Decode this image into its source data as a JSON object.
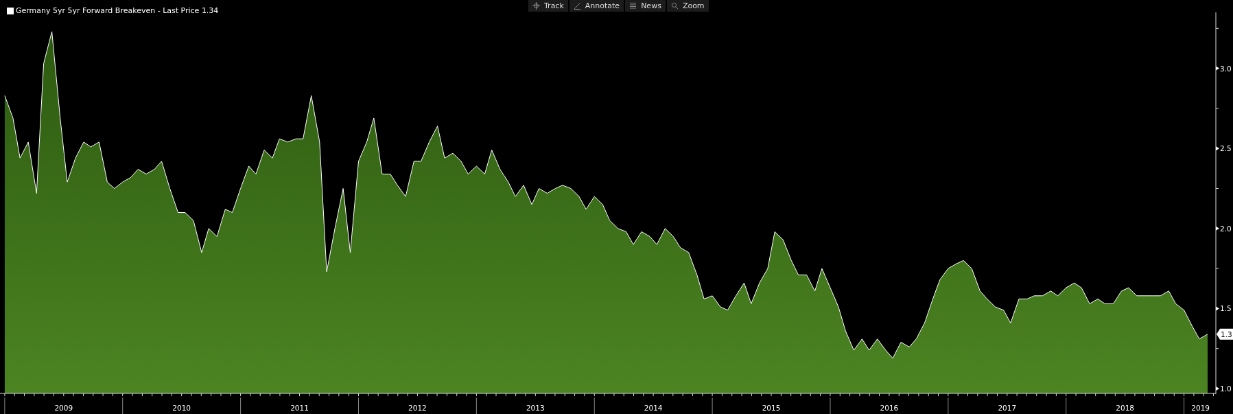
{
  "legend": {
    "label": "Germany 5yr 5yr Forward Breakeven - Last Price 1.34"
  },
  "toolbar": [
    {
      "kind": "track",
      "label": "Track"
    },
    {
      "kind": "annotate",
      "label": "Annotate"
    },
    {
      "kind": "news",
      "label": "News"
    },
    {
      "kind": "zoom",
      "label": "Zoom"
    }
  ],
  "last_price_badge": "1.3",
  "chart_data": {
    "type": "area",
    "x": [
      2009,
      2009.07,
      2009.13,
      2009.2,
      2009.27,
      2009.33,
      2009.4,
      2009.47,
      2009.53,
      2009.6,
      2009.67,
      2009.73,
      2009.8,
      2009.87,
      2009.93,
      2010,
      2010.07,
      2010.13,
      2010.2,
      2010.27,
      2010.33,
      2010.4,
      2010.47,
      2010.53,
      2010.6,
      2010.67,
      2010.73,
      2010.8,
      2010.87,
      2010.93,
      2011,
      2011.07,
      2011.13,
      2011.2,
      2011.27,
      2011.33,
      2011.4,
      2011.47,
      2011.53,
      2011.6,
      2011.67,
      2011.73,
      2011.8,
      2011.87,
      2011.93,
      2012,
      2012.07,
      2012.13,
      2012.2,
      2012.27,
      2012.33,
      2012.4,
      2012.47,
      2012.53,
      2012.6,
      2012.67,
      2012.73,
      2012.8,
      2012.87,
      2012.93,
      2013,
      2013.07,
      2013.13,
      2013.2,
      2013.27,
      2013.33,
      2013.4,
      2013.47,
      2013.53,
      2013.6,
      2013.67,
      2013.73,
      2013.8,
      2013.87,
      2013.93,
      2014,
      2014.07,
      2014.13,
      2014.2,
      2014.27,
      2014.33,
      2014.4,
      2014.47,
      2014.53,
      2014.6,
      2014.67,
      2014.73,
      2014.8,
      2014.87,
      2014.93,
      2015,
      2015.07,
      2015.13,
      2015.2,
      2015.27,
      2015.33,
      2015.4,
      2015.47,
      2015.53,
      2015.6,
      2015.67,
      2015.73,
      2015.8,
      2015.87,
      2015.93,
      2016,
      2016.07,
      2016.13,
      2016.2,
      2016.27,
      2016.33,
      2016.4,
      2016.47,
      2016.53,
      2016.6,
      2016.67,
      2016.73,
      2016.8,
      2016.87,
      2016.93,
      2017,
      2017.07,
      2017.13,
      2017.2,
      2017.27,
      2017.33,
      2017.4,
      2017.47,
      2017.53,
      2017.6,
      2017.67,
      2017.73,
      2017.8,
      2017.87,
      2017.93,
      2018,
      2018.07,
      2018.13,
      2018.2,
      2018.27,
      2018.33,
      2018.4,
      2018.47,
      2018.53,
      2018.6,
      2018.67,
      2018.73,
      2018.8,
      2018.87,
      2018.93,
      2019,
      2019.07,
      2019.13,
      2019.2
    ],
    "series": [
      {
        "color": "#ffffff",
        "values": [
          2.83,
          2.69,
          2.44,
          2.54,
          2.22,
          3.03,
          3.23,
          2.69,
          2.29,
          2.44,
          2.54,
          2.51,
          2.54,
          2.29,
          2.25,
          2.29,
          2.32,
          2.37,
          2.34,
          2.37,
          2.42,
          2.25,
          2.1,
          2.1,
          2.05,
          1.85,
          2.0,
          1.95,
          2.12,
          2.1,
          2.25,
          2.39,
          2.34,
          2.49,
          2.44,
          2.56,
          2.54,
          2.56,
          2.56,
          2.83,
          2.54,
          1.73,
          2.0,
          2.25,
          1.85,
          2.42,
          2.54,
          2.69,
          2.34,
          2.34,
          2.27,
          2.2,
          2.42,
          2.42,
          2.54,
          2.64,
          2.44,
          2.47,
          2.42,
          2.34,
          2.39,
          2.34,
          2.49,
          2.37,
          2.29,
          2.2,
          2.27,
          2.15,
          2.25,
          2.22,
          2.25,
          2.27,
          2.25,
          2.2,
          2.12,
          2.2,
          2.15,
          2.05,
          2.0,
          1.98,
          1.9,
          1.98,
          1.95,
          1.9,
          2.0,
          1.95,
          1.88,
          1.85,
          1.71,
          1.56,
          1.58,
          1.51,
          1.49,
          1.58,
          1.66,
          1.53,
          1.66,
          1.75,
          1.98,
          1.93,
          1.8,
          1.71,
          1.71,
          1.61,
          1.75,
          1.63,
          1.51,
          1.36,
          1.24,
          1.31,
          1.24,
          1.31,
          1.24,
          1.19,
          1.29,
          1.26,
          1.31,
          1.41,
          1.56,
          1.68,
          1.75,
          1.78,
          1.8,
          1.75,
          1.61,
          1.56,
          1.51,
          1.49,
          1.41,
          1.56,
          1.56,
          1.58,
          1.58,
          1.61,
          1.58,
          1.63,
          1.66,
          1.63,
          1.53,
          1.56,
          1.53,
          1.53,
          1.61,
          1.63,
          1.58,
          1.58,
          1.58,
          1.58,
          1.61,
          1.53,
          1.49,
          1.39,
          1.31,
          1.34
        ]
      }
    ],
    "xlim": [
      2008.96,
      2019.27
    ],
    "ylim": [
      0.97,
      3.35
    ],
    "xticks": [
      {
        "value": 2009.5,
        "label": "2009"
      },
      {
        "value": 2010.5,
        "label": "2010"
      },
      {
        "value": 2011.5,
        "label": "2011"
      },
      {
        "value": 2012.5,
        "label": "2012"
      },
      {
        "value": 2013.5,
        "label": "2013"
      },
      {
        "value": 2014.5,
        "label": "2014"
      },
      {
        "value": 2015.5,
        "label": "2015"
      },
      {
        "value": 2016.5,
        "label": "2016"
      },
      {
        "value": 2017.5,
        "label": "2017"
      },
      {
        "value": 2018.5,
        "label": "2018"
      },
      {
        "value": 2019.14,
        "label": "2019"
      }
    ],
    "yticks": [
      {
        "value": 1.0,
        "label": "1.0"
      },
      {
        "value": 1.5,
        "label": "1.5"
      },
      {
        "value": 2.0,
        "label": "2.0"
      },
      {
        "value": 2.5,
        "label": "2.5"
      },
      {
        "value": 3.0,
        "label": "3.0"
      }
    ]
  }
}
